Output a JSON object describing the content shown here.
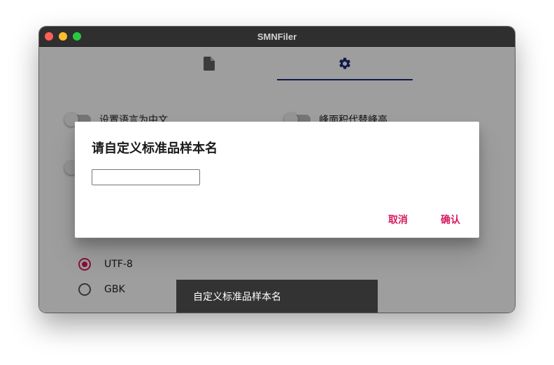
{
  "window": {
    "title": "SMNFiler"
  },
  "tabs": [
    {
      "name": "files",
      "icon": "file-icon",
      "selected": false
    },
    {
      "name": "settings",
      "icon": "gear-icon",
      "selected": true
    }
  ],
  "colors": {
    "accent": "#d81b60",
    "tab_indicator": "#1e2a78",
    "titlebar": "#2f2f30"
  },
  "settings": {
    "toggles": [
      {
        "label": "设置语言为中文",
        "on": false
      },
      {
        "label": "峰面积代替峰高",
        "on": false
      },
      {
        "label": "",
        "on": false
      }
    ],
    "encoding": {
      "options": [
        {
          "label": "UTF-8",
          "selected": true
        },
        {
          "label": "GBK",
          "selected": false
        }
      ]
    }
  },
  "snackbar": {
    "label": "自定义标准品样本名"
  },
  "dialog": {
    "title": "请自定义标准品样本名",
    "input": {
      "value": "",
      "placeholder": ""
    },
    "cancel_label": "取消",
    "confirm_label": "确认"
  }
}
